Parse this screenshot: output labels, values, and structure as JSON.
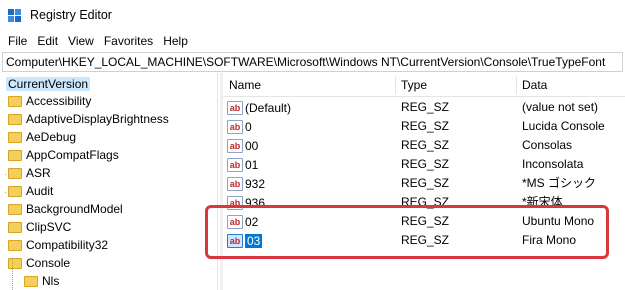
{
  "window": {
    "title": "Registry Editor",
    "icon": "registry-editor-icon"
  },
  "menu": [
    "File",
    "Edit",
    "View",
    "Favorites",
    "Help"
  ],
  "address": "Computer\\HKEY_LOCAL_MACHINE\\SOFTWARE\\Microsoft\\Windows NT\\CurrentVersion\\Console\\TrueTypeFont",
  "tree": {
    "items": [
      "CurrentVersion",
      "Accessibility",
      "AdaptiveDisplayBrightness",
      "AeDebug",
      "AppCompatFlags",
      "ASR",
      "Audit",
      "BackgroundModel",
      "ClipSVC",
      "Compatibility32",
      "Console",
      "Nls"
    ]
  },
  "list": {
    "columns": [
      "Name",
      "Type",
      "Data"
    ],
    "rows": [
      {
        "name": "(Default)",
        "type": "REG_SZ",
        "data": "(value not set)"
      },
      {
        "name": "0",
        "type": "REG_SZ",
        "data": "Lucida Console"
      },
      {
        "name": "00",
        "type": "REG_SZ",
        "data": "Consolas"
      },
      {
        "name": "01",
        "type": "REG_SZ",
        "data": "Inconsolata"
      },
      {
        "name": "932",
        "type": "REG_SZ",
        "data": "*MS ゴシック"
      },
      {
        "name": "936",
        "type": "REG_SZ",
        "data": "*新宋体"
      },
      {
        "name": "02",
        "type": "REG_SZ",
        "data": "Ubuntu Mono"
      },
      {
        "name": "03",
        "type": "REG_SZ",
        "data": "Fira Mono"
      }
    ],
    "selected_row": "03",
    "value_icon": "string-value-icon"
  },
  "annotation": {
    "color": "#d9363e"
  }
}
